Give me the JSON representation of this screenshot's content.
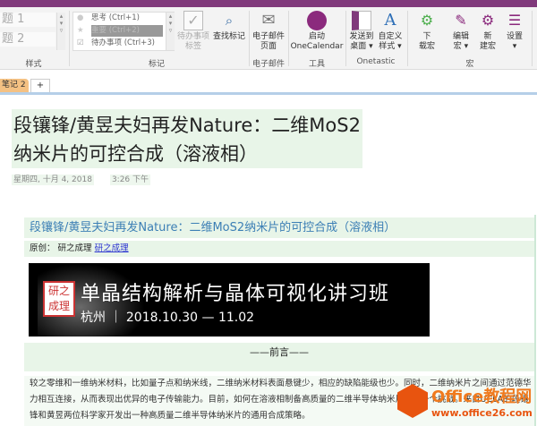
{
  "ribbon": {
    "styles": {
      "items": [
        "题 1",
        "题 2"
      ],
      "label": "样式"
    },
    "tags": {
      "items": [
        "思考 (Ctrl+1)",
        "重要 (Ctrl+2)",
        "待办事项 (Ctrl+3)"
      ],
      "label": "标记"
    },
    "todo_tag": {
      "line1": "待办事项",
      "line2": "标签"
    },
    "find_tags": "查找标记",
    "email": {
      "line1": "电子邮件",
      "line2": "页面",
      "label": "电子邮件"
    },
    "onecalendar": {
      "line1": "启动",
      "line2": "OneCalendar",
      "label": "工具"
    },
    "send_desktop": {
      "line1": "发送到",
      "line2": "桌面 ▾"
    },
    "custom_style": {
      "line1": "自定义",
      "line2": "样式 ▾"
    },
    "onetastic_label": "Onetastic",
    "download_macro": {
      "line1": "下",
      "line2": "载宏"
    },
    "edit_macro": {
      "line1": "编辑",
      "line2": "宏 ▾"
    },
    "new_macro": {
      "line1": "新",
      "line2": "建宏"
    },
    "settings": {
      "line1": "设置",
      "line2": "▾"
    },
    "macro_label": "宏"
  },
  "tabs": {
    "section": "笔记 2",
    "add": "+"
  },
  "page": {
    "title": "段镶锋/黄昱夫妇再发Nature：二维MoS2纳米片的可控合成（溶液相）",
    "date": "星期四, 十月 4, 2018",
    "time": "3:26 下午",
    "heading": "段镶锋/黄昱夫妇再发Nature：二维MoS2纳米片的可控合成（溶液相）",
    "original_label": "原创：",
    "original_author": "研之成理",
    "original_link": "研之成理",
    "banner": {
      "seal": "研之成理",
      "title": "单晶结构解析与晶体可视化讲习班",
      "subtitle": "杭州 ｜ 2018.10.30 — 11.02"
    },
    "foreword": "——前言——",
    "paragraph": "较之零维和一维纳米材料，比如量子点和纳米线，二维纳米材料表面悬键少，相应的缺陷能级也少。同时，二维纳米片之间通过范德华力相互连接，从而表现出优异的电子传输能力。目前，如何在溶液相制备高质量的二维半导体纳米片仍是一个挑战。来自UCLA的段镶锋和黄昱两位科学家开发出一种高质量二维半导体纳米片的通用合成策略。"
  },
  "watermark": {
    "name": "Office教程网",
    "url": "www.office26.com"
  },
  "colors": {
    "accent": "#80397b",
    "title_bg": "#e8f5e8",
    "heading": "#3c7fb5",
    "tab": "#f4c183"
  }
}
